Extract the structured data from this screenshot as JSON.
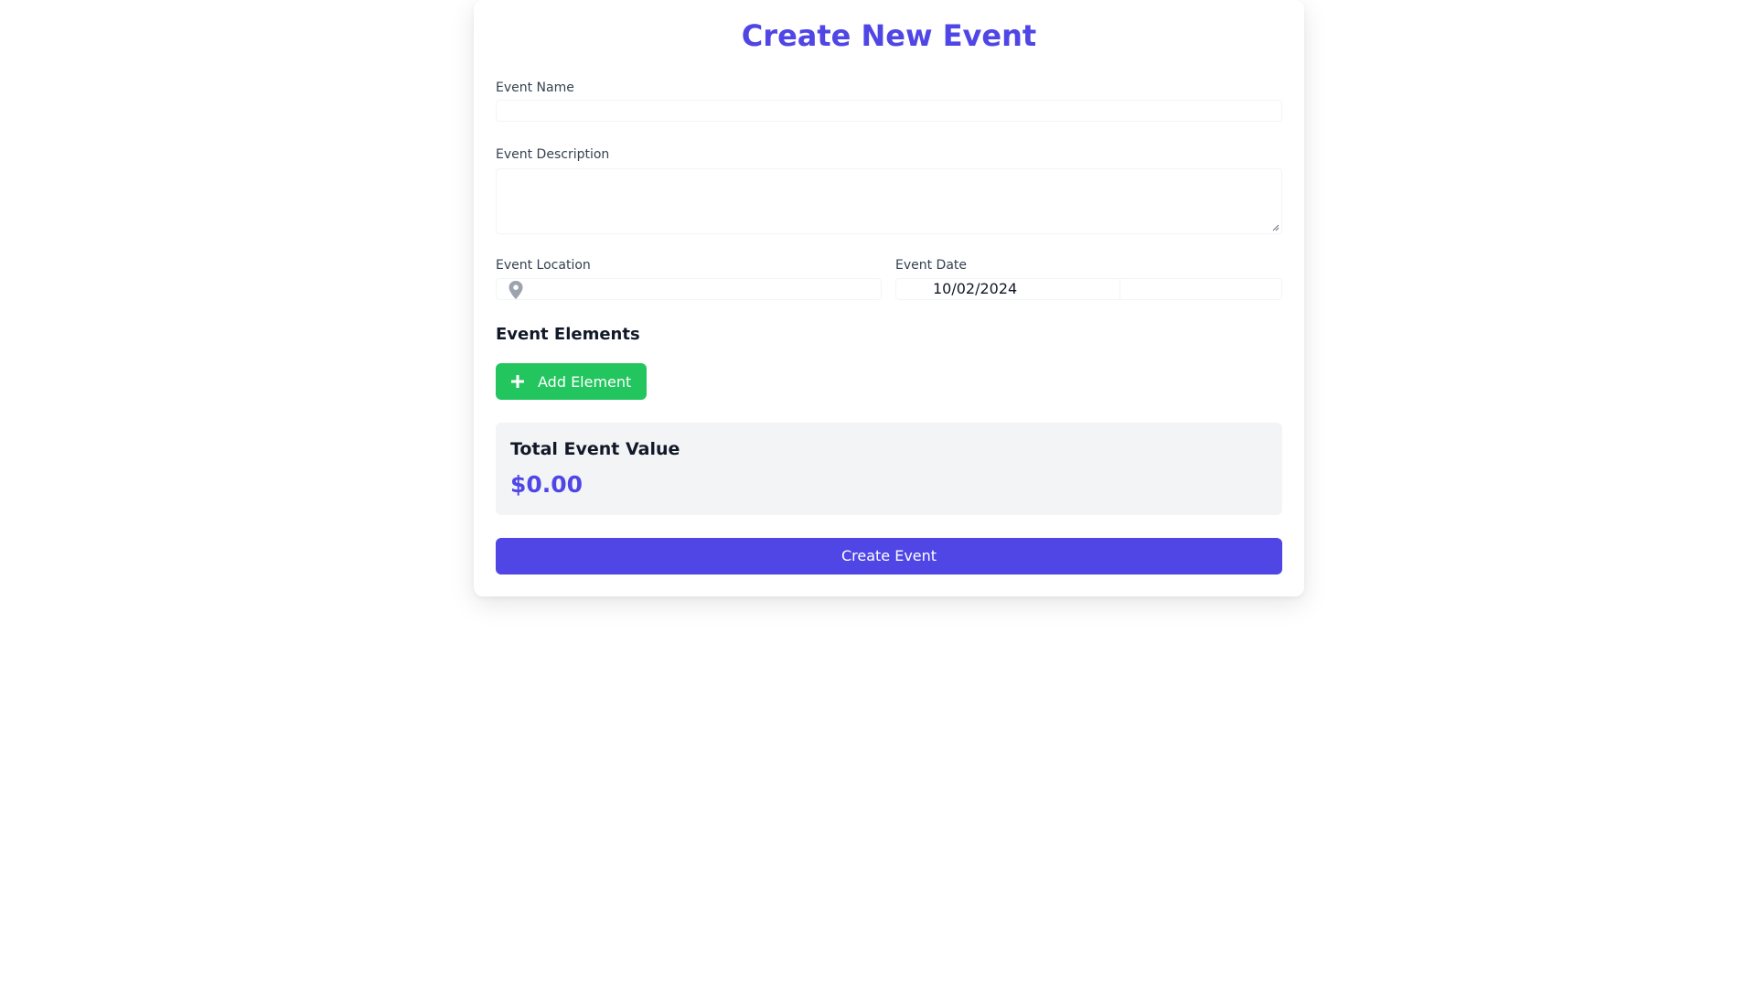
{
  "form": {
    "title": "Create New Event",
    "event_name": {
      "label": "Event Name",
      "value": ""
    },
    "event_description": {
      "label": "Event Description",
      "value": ""
    },
    "event_location": {
      "label": "Event Location",
      "value": "",
      "icon": "map-pin-icon"
    },
    "event_date": {
      "label": "Event Date",
      "value": "10/02/2024"
    },
    "elements_section": {
      "title": "Event Elements",
      "add_button_label": "Add Element",
      "add_icon": "plus-icon"
    },
    "total": {
      "label": "Total Event Value",
      "value": "$0.00"
    },
    "submit_label": "Create Event"
  },
  "colors": {
    "primary": "#4f46e5",
    "success": "#22c55e",
    "panel": "#f3f4f6"
  }
}
